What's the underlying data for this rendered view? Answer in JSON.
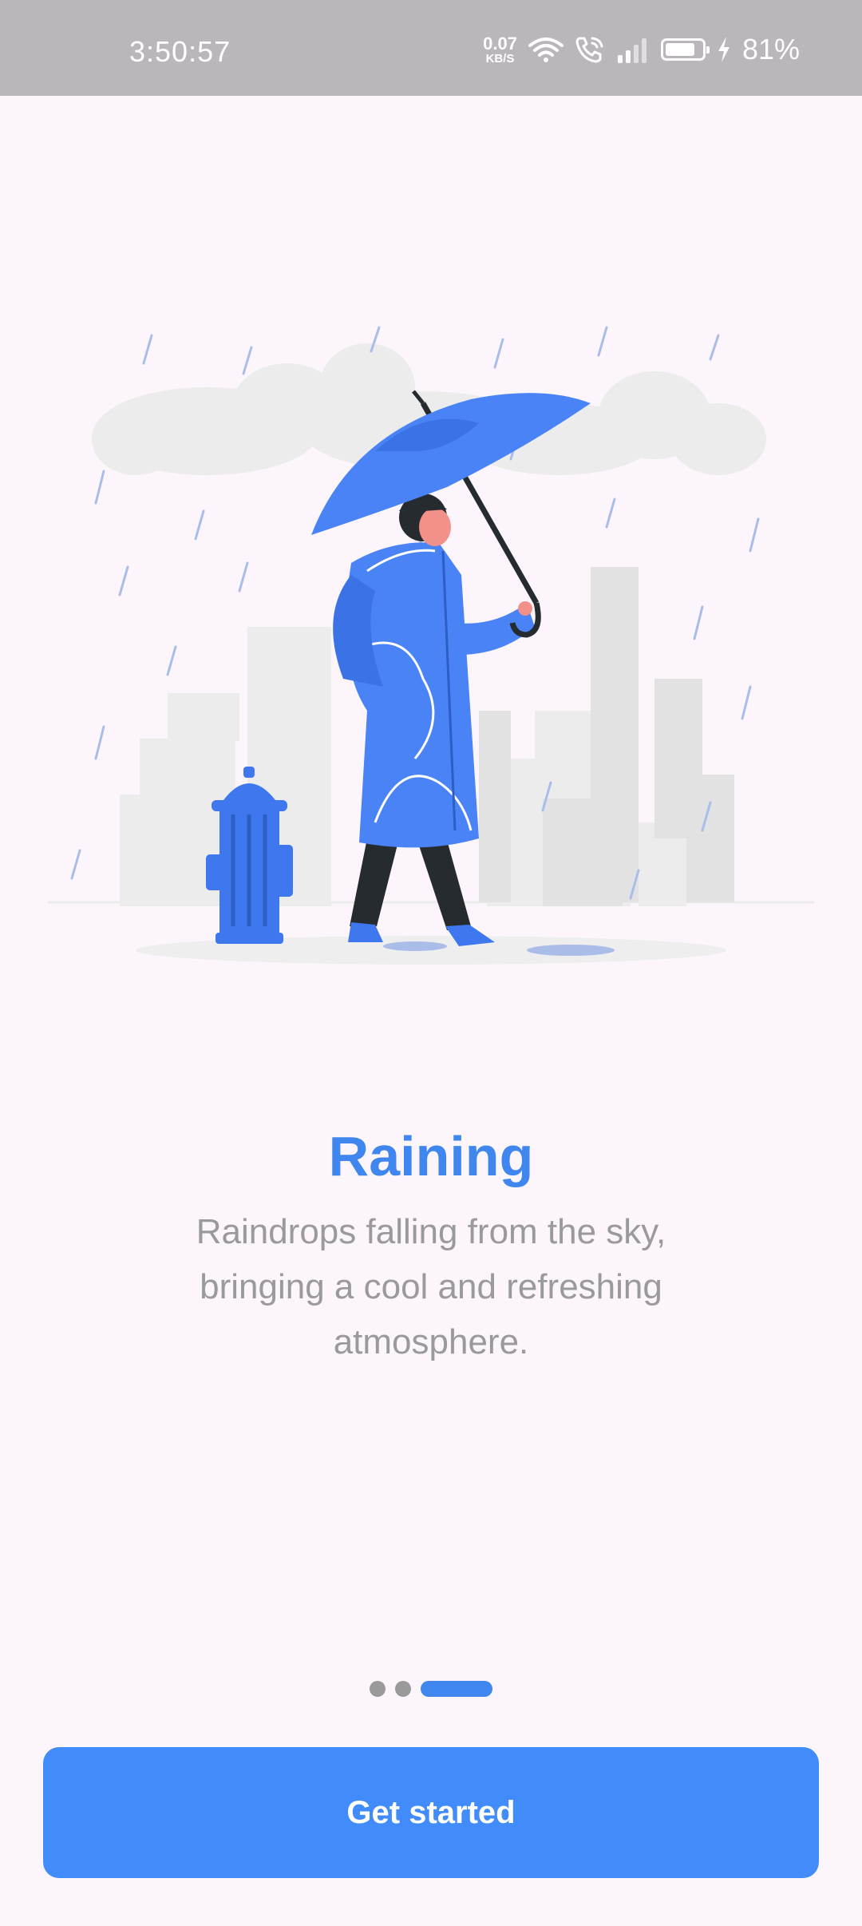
{
  "status_bar": {
    "time": "3:50:57",
    "net_speed_value": "0.07",
    "net_speed_unit": "KB/S",
    "battery_percent": "81%",
    "battery_level": 0.81
  },
  "onboarding": {
    "title": "Raining",
    "description": "Raindrops falling from the sky, bringing a cool and refreshing atmosphere.",
    "page_count": 3,
    "active_page": 3,
    "illustration_icon": "woman-with-umbrella-in-rain-illustration"
  },
  "actions": {
    "get_started_label": "Get started"
  },
  "colors": {
    "accent": "#418bfa",
    "title": "#3f86ee",
    "description": "#9a9a9a",
    "background": "#fcf6fc",
    "status_bar": "#bab6bb"
  }
}
